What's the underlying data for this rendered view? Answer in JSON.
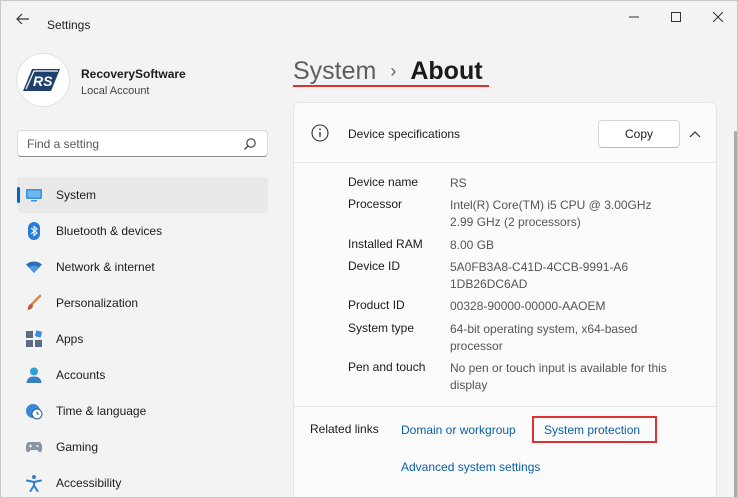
{
  "window": {
    "title": "Settings"
  },
  "account": {
    "name": "RecoverySoftware",
    "type": "Local Account",
    "avatar_text": "RS"
  },
  "search": {
    "placeholder": "Find a setting"
  },
  "nav": {
    "items": [
      {
        "label": "System",
        "icon": "monitor-icon"
      },
      {
        "label": "Bluetooth & devices",
        "icon": "bluetooth-icon"
      },
      {
        "label": "Network & internet",
        "icon": "wifi-icon"
      },
      {
        "label": "Personalization",
        "icon": "brush-icon"
      },
      {
        "label": "Apps",
        "icon": "apps-icon"
      },
      {
        "label": "Accounts",
        "icon": "person-icon"
      },
      {
        "label": "Time & language",
        "icon": "clock-globe-icon"
      },
      {
        "label": "Gaming",
        "icon": "gamepad-icon"
      },
      {
        "label": "Accessibility",
        "icon": "accessibility-icon"
      }
    ]
  },
  "header": {
    "crumb_parent": "System",
    "crumb_separator": "›",
    "crumb_current": "About"
  },
  "device_specs": {
    "title": "Device specifications",
    "copy_label": "Copy",
    "rows": [
      {
        "label": "Device name",
        "value": "RS"
      },
      {
        "label": "Processor",
        "value": "Intel(R) Core(TM) i5 CPU @ 3.00GHz   2.99 GHz  (2 processors)"
      },
      {
        "label": "Installed RAM",
        "value": "8.00 GB"
      },
      {
        "label": "Device ID",
        "value": "5A0FB3A8-C41D-4CCB-9991-A61DB26DC6AD"
      },
      {
        "label": "Product ID",
        "value": "00328-90000-00000-AAOEM"
      },
      {
        "label": "System type",
        "value": "64-bit operating system, x64-based processor"
      },
      {
        "label": "Pen and touch",
        "value": "No pen or touch input is available for this display"
      }
    ]
  },
  "related": {
    "label": "Related links",
    "domain": "Domain or workgroup",
    "protection": "System protection",
    "advanced": "Advanced system settings"
  },
  "colors": {
    "accent": "#0067c0",
    "link": "#0a5ea8",
    "highlight": "#e03131"
  }
}
